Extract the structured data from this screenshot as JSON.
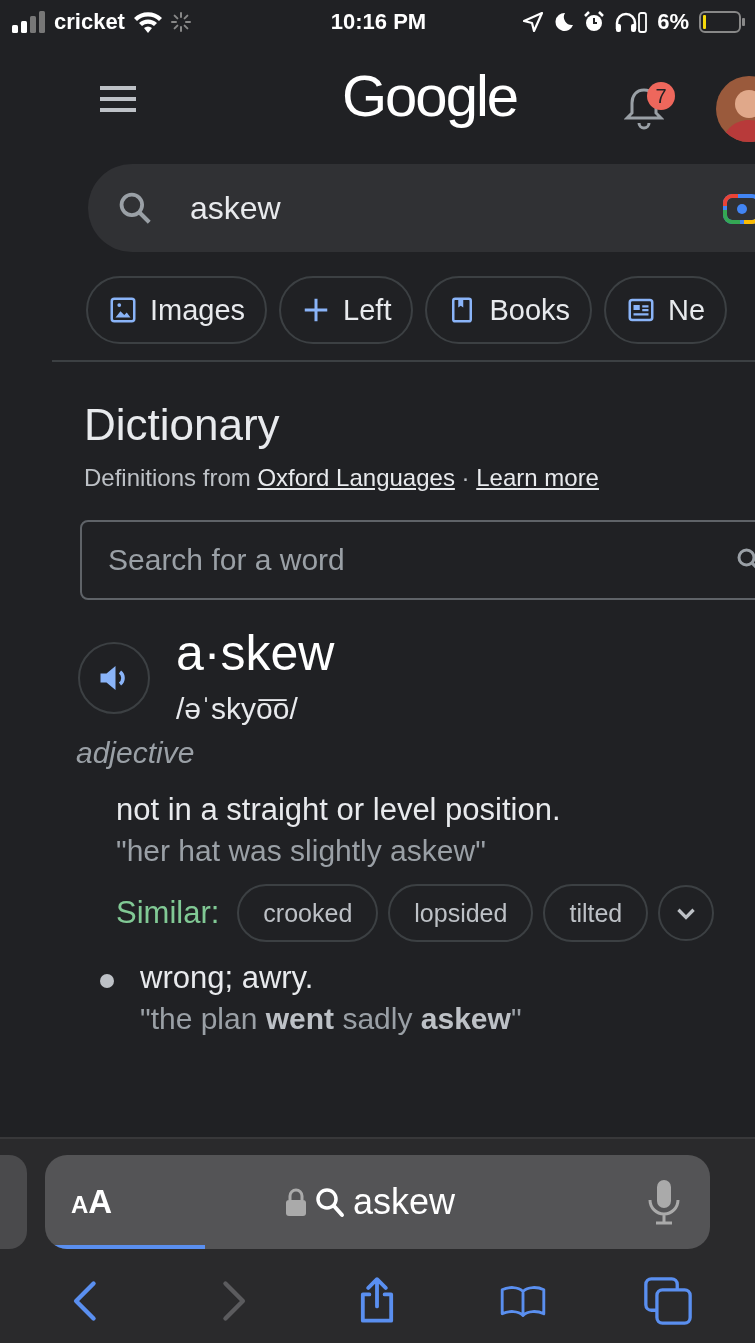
{
  "status_bar": {
    "carrier": "cricket",
    "time": "10:16 PM",
    "battery": "6%"
  },
  "header": {
    "logo": "Google",
    "notifications": "7"
  },
  "search": {
    "value": "askew"
  },
  "chips": [
    {
      "label": "Images",
      "kind": "image"
    },
    {
      "label": "Left",
      "kind": "plus"
    },
    {
      "label": "Books",
      "kind": "book"
    },
    {
      "label": "Ne",
      "kind": "news"
    }
  ],
  "dictionary": {
    "title": "Dictionary",
    "source_prefix": "Definitions from",
    "source_link": "Oxford Languages",
    "separator": "·",
    "learn_more": "Learn more",
    "search_placeholder": "Search for a word",
    "word": "a·skew",
    "pronunciation": "/əˈskyo͞o/",
    "part_of_speech": "adjective",
    "senses": [
      {
        "definition": "not in a straight or level position.",
        "example": "\"her hat was slightly askew\"",
        "similar_label": "Similar:",
        "similar": [
          "crooked",
          "lopsided",
          "tilted"
        ],
        "bullet": false
      },
      {
        "definition": "wrong; awry.",
        "example": "\"the plan **went** sadly **askew**\"",
        "bullet": true
      }
    ]
  },
  "browser": {
    "text_size": "AA",
    "address": "askew",
    "level": 0.24,
    "nav": [
      {
        "kind": "back",
        "disabled": false
      },
      {
        "kind": "forward",
        "disabled": true
      },
      {
        "kind": "share",
        "disabled": false
      },
      {
        "kind": "bookmarks",
        "disabled": false
      },
      {
        "kind": "tabs",
        "disabled": false
      }
    ]
  }
}
